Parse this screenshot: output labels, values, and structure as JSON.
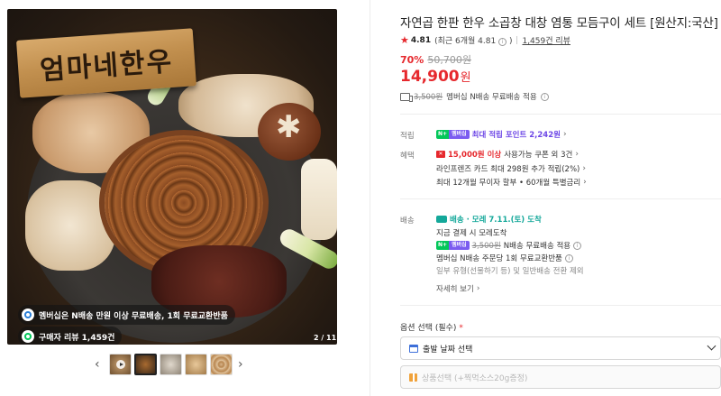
{
  "gallery": {
    "sign_text": "엄마네한우",
    "badge_membership": "멤버십은 N배송 만원 이상 무료배송, 1회 무료교환반품",
    "badge_reviews": "구매자 리뷰 1,459건",
    "counter": "2 / 11",
    "prev_label": "‹",
    "next_label": "›",
    "thumbnails": [
      "video",
      "image",
      "image",
      "image",
      "image"
    ]
  },
  "product": {
    "title": "자연곱 한판 한우 소곱창 대창 염통 모듬구이 세트 [원산지:국산]",
    "rating": "4.81",
    "rating_detail": "(최근 6개월 4.81",
    "review_count": "1,459건 리뷰",
    "discount": "70%",
    "original_price": "50,700원",
    "price": "14,900",
    "price_unit": "원",
    "shipping_fee_strike": "3,500원",
    "shipping_text": "멤버십 N배송 무료배송 적용"
  },
  "benefits": {
    "points_label": "적립",
    "points_text": "최대 적립 포인트 2,242원",
    "perks_label": "혜택",
    "coupon_amount": "15,000원 이상",
    "coupon_text": "사용가능 쿠폰 외 3건",
    "card_text": "라인프렌즈 카드 최대 298원 추가 적립(2%)",
    "installment_text": "최대 12개월 무이자 할부 • 60개월 특별금리"
  },
  "delivery": {
    "label": "배송",
    "arrival": "배송 · 모레 7.11.(토) 도착",
    "pay_note": "지금 결제 시 모레도착",
    "fee_strike": "3,500원",
    "fee_text": "N배송 무료배송 적용",
    "exchange_text": "멤버십 N배송 주문당 1회 무료교환반품",
    "exception_text": "일부 유형(선물하기 등) 및 일반배송 전환 제외",
    "details_link": "자세히 보기"
  },
  "options": {
    "label": "옵션 선택 (필수)",
    "required_mark": "*",
    "date_select": "출발 날짜 선택",
    "product_select": "상품선택 (+찍먹소스20g증정)"
  },
  "colors": {
    "accent_red": "#e6282d",
    "naver_green": "#03c75a",
    "points_purple": "#6d47e6",
    "delivery_teal": "#14a89a"
  }
}
